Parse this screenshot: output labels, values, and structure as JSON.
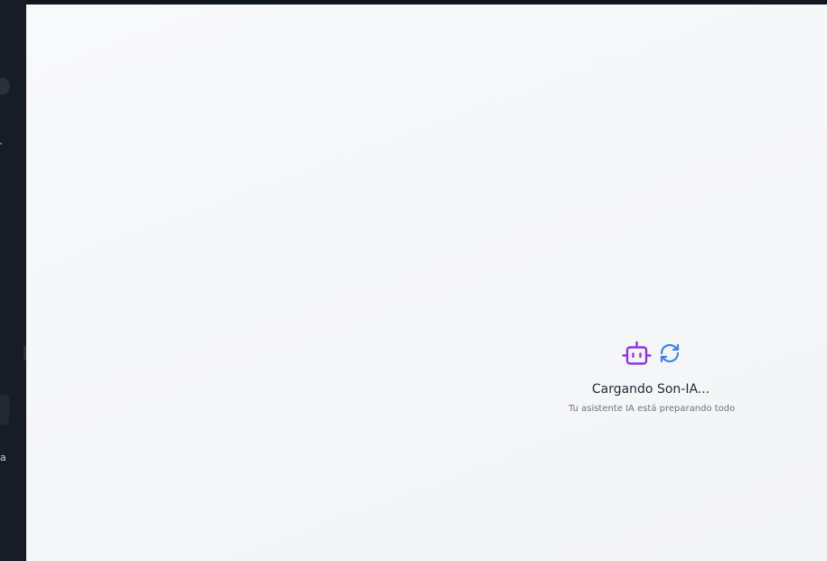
{
  "sidebar": {
    "partial_label": "a"
  },
  "loading": {
    "title": "Cargando Son-IA...",
    "subtitle": "Tu asistente IA está preparando todo",
    "icons": [
      "bot-icon",
      "refresh-icon"
    ]
  },
  "colors": {
    "sidebar_bg": "#171c27",
    "main_bg": "#f6f7f9",
    "bot_icon": "#9333ea",
    "refresh_icon": "#3b82f6",
    "title": "#1f2937",
    "subtitle": "#6b7280"
  }
}
